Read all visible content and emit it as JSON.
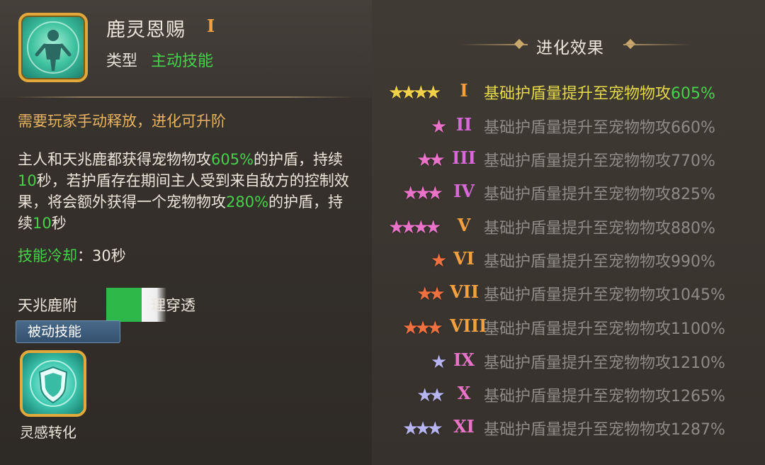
{
  "skill": {
    "name": "鹿灵恩赐",
    "rank": "I",
    "type_label": "类型",
    "type_value": "主动技能",
    "note": "需要玩家手动释放，进化可升阶",
    "desc": {
      "p1": "主人和天兆鹿都获得宠物物攻",
      "v1": "605%",
      "p2": "的护盾，持续",
      "v2": "10",
      "p3": "秒，若护盾存在期间主人受到来自敌方的控制效果，将会额外获得一个宠物物攻",
      "v3": "280%",
      "p4": "的护盾，持续",
      "v4": "10",
      "p5": "秒"
    },
    "cooldown_label": "技能冷却",
    "cooldown_sep": "：",
    "cooldown_value": "30秒"
  },
  "passive": {
    "name_head": "天兆鹿附",
    "name_tail": "理穿透",
    "badge": "被动技能",
    "icon_label": "灵感转化"
  },
  "evolution": {
    "title": "进化效果",
    "rows": [
      {
        "stars": 4,
        "star_color": "#f2d14a",
        "roman": "I",
        "roman_color": "#f2a040",
        "prefix": "基础护盾量提升至宠物物攻",
        "pct": "605%",
        "active": true
      },
      {
        "stars": 1,
        "star_color": "#e873c8",
        "roman": "II",
        "roman_color": "#d968d8",
        "prefix": "基础护盾量提升至宠物物攻",
        "pct": "660%",
        "active": false
      },
      {
        "stars": 2,
        "star_color": "#e873c8",
        "roman": "III",
        "roman_color": "#d968d8",
        "prefix": "基础护盾量提升至宠物物攻",
        "pct": "770%",
        "active": false
      },
      {
        "stars": 3,
        "star_color": "#e873c8",
        "roman": "IV",
        "roman_color": "#d968d8",
        "prefix": "基础护盾量提升至宠物物攻",
        "pct": "825%",
        "active": false
      },
      {
        "stars": 4,
        "star_color": "#e873c8",
        "roman": "V",
        "roman_color": "#f2a040",
        "prefix": "基础护盾量提升至宠物物攻",
        "pct": "880%",
        "active": false
      },
      {
        "stars": 1,
        "star_color": "#f07040",
        "roman": "VI",
        "roman_color": "#f2a040",
        "prefix": "基础护盾量提升至宠物物攻",
        "pct": "990%",
        "active": false
      },
      {
        "stars": 2,
        "star_color": "#f07040",
        "roman": "VII",
        "roman_color": "#f2a040",
        "prefix": "基础护盾量提升至宠物物攻",
        "pct": "1045%",
        "active": false
      },
      {
        "stars": 3,
        "star_color": "#f07040",
        "roman": "VIII",
        "roman_color": "#f2a040",
        "prefix": "基础护盾量提升至宠物物攻",
        "pct": "1100%",
        "active": false
      },
      {
        "stars": 1,
        "star_color": "#b8b4f2",
        "roman": "IX",
        "roman_color": "#e873c8",
        "prefix": "基础护盾量提升至宠物物攻",
        "pct": "1210%",
        "active": false
      },
      {
        "stars": 2,
        "star_color": "#b8b4f2",
        "roman": "X",
        "roman_color": "#e873c8",
        "prefix": "基础护盾量提升至宠物物攻",
        "pct": "1265%",
        "active": false
      },
      {
        "stars": 3,
        "star_color": "#b8b4f2",
        "roman": "XI",
        "roman_color": "#e873c8",
        "prefix": "基础护盾量提升至宠物物攻",
        "pct": "1287%",
        "active": false
      }
    ]
  }
}
